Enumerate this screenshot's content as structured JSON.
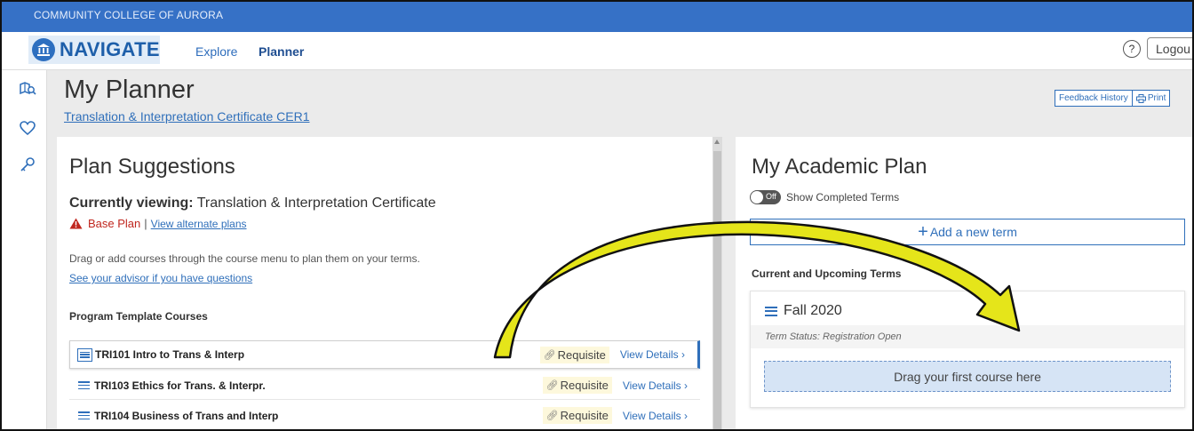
{
  "college": {
    "name": "COMMUNITY COLLEGE OF AURORA"
  },
  "nav": {
    "brand": "NAVIGATE",
    "links": [
      "Explore",
      "Planner"
    ],
    "active": "Planner",
    "help_icon": "help-circle-icon",
    "help_text": "?",
    "logout": "Logou"
  },
  "sidebar": {
    "icons": [
      "map-search-icon",
      "heart-icon",
      "key-icon"
    ]
  },
  "header": {
    "title": "My Planner",
    "program": "Translation & Interpretation Certificate CER1",
    "feedback": "Feedback History",
    "print": "Print",
    "print_icon": "printer-icon"
  },
  "left": {
    "title": "Plan Suggestions",
    "viewing_label": "Currently viewing:",
    "viewing_value": "Translation & Interpretation Certificate",
    "base_plan": "Base Plan",
    "separator": "|",
    "alternate_link": "View alternate plans",
    "drag_hint": "Drag or add courses through the course menu to plan them on your terms.",
    "advisor_link": "See your advisor if you have questions",
    "template_heading": "Program Template Courses",
    "courses": [
      {
        "name": "TRI101 Intro to Trans & Interp",
        "tag": "Requisite",
        "details": "View Details"
      },
      {
        "name": "TRI103 Ethics for Trans. & Interpr.",
        "tag": "Requisite",
        "details": "View Details"
      },
      {
        "name": "TRI104 Business of Trans and Interp",
        "tag": "Requisite",
        "details": "View Details"
      }
    ]
  },
  "right": {
    "title": "My Academic Plan",
    "toggle_state": "Off",
    "toggle_label": "Show Completed Terms",
    "add_term": "Add a new term",
    "plus": "+",
    "terms_heading": "Current and Upcoming Terms",
    "term": {
      "name": "Fall 2020",
      "status": "Term Status: Registration Open",
      "drop_hint": "Drag your first course here"
    }
  },
  "colors": {
    "college_bar": "#3671c6",
    "accent": "#2f6fba",
    "arrow_fill": "#e5e51a",
    "alert_red": "#c0271f"
  }
}
